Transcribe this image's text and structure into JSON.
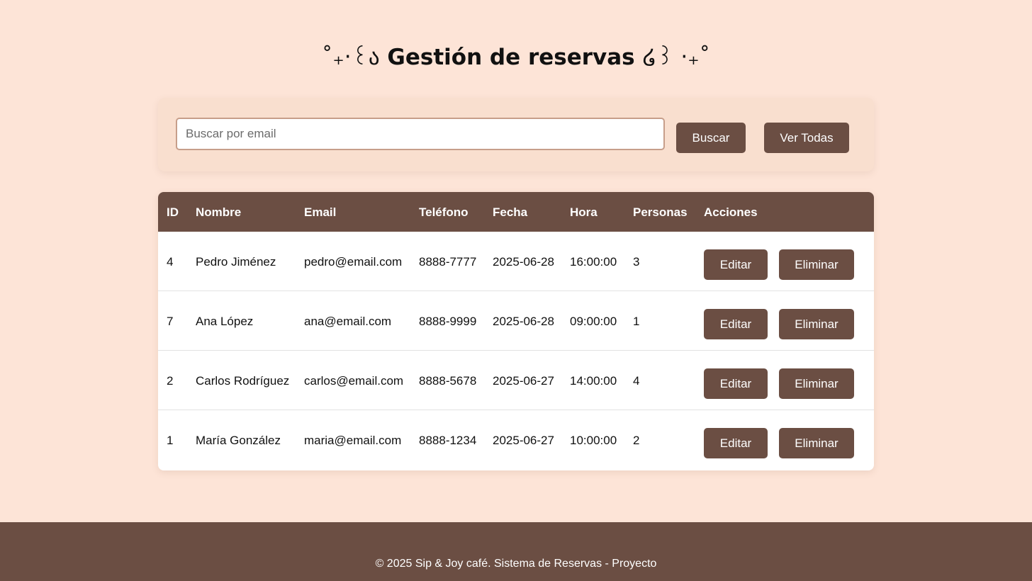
{
  "header": {
    "deco_left": "˚₊‧꒰ა",
    "title": "Gestión de reservas",
    "deco_right": "໒꒱ ‧₊˚"
  },
  "search": {
    "placeholder": "Buscar por email",
    "value": "",
    "search_label": "Buscar",
    "view_all_label": "Ver Todas"
  },
  "table": {
    "columns": [
      "ID",
      "Nombre",
      "Email",
      "Teléfono",
      "Fecha",
      "Hora",
      "Personas",
      "Acciones"
    ],
    "rows": [
      {
        "id": "4",
        "nombre": "Pedro Jiménez",
        "email": "pedro@email.com",
        "telefono": "8888-7777",
        "fecha": "2025-06-28",
        "hora": "16:00:00",
        "personas": "3"
      },
      {
        "id": "7",
        "nombre": "Ana López",
        "email": "ana@email.com",
        "telefono": "8888-9999",
        "fecha": "2025-06-28",
        "hora": "09:00:00",
        "personas": "1"
      },
      {
        "id": "2",
        "nombre": "Carlos Rodríguez",
        "email": "carlos@email.com",
        "telefono": "8888-5678",
        "fecha": "2025-06-27",
        "hora": "14:00:00",
        "personas": "4"
      },
      {
        "id": "1",
        "nombre": "María González",
        "email": "maria@email.com",
        "telefono": "8888-1234",
        "fecha": "2025-06-27",
        "hora": "10:00:00",
        "personas": "2"
      }
    ],
    "actions": {
      "edit_label": "Editar",
      "delete_label": "Eliminar"
    }
  },
  "footer": {
    "text": "© 2025 Sip & Joy café. Sistema de Reservas - Proyecto"
  },
  "colors": {
    "background": "#fde4d7",
    "accent": "#6b4e43",
    "panel": "#f9dfcf"
  }
}
